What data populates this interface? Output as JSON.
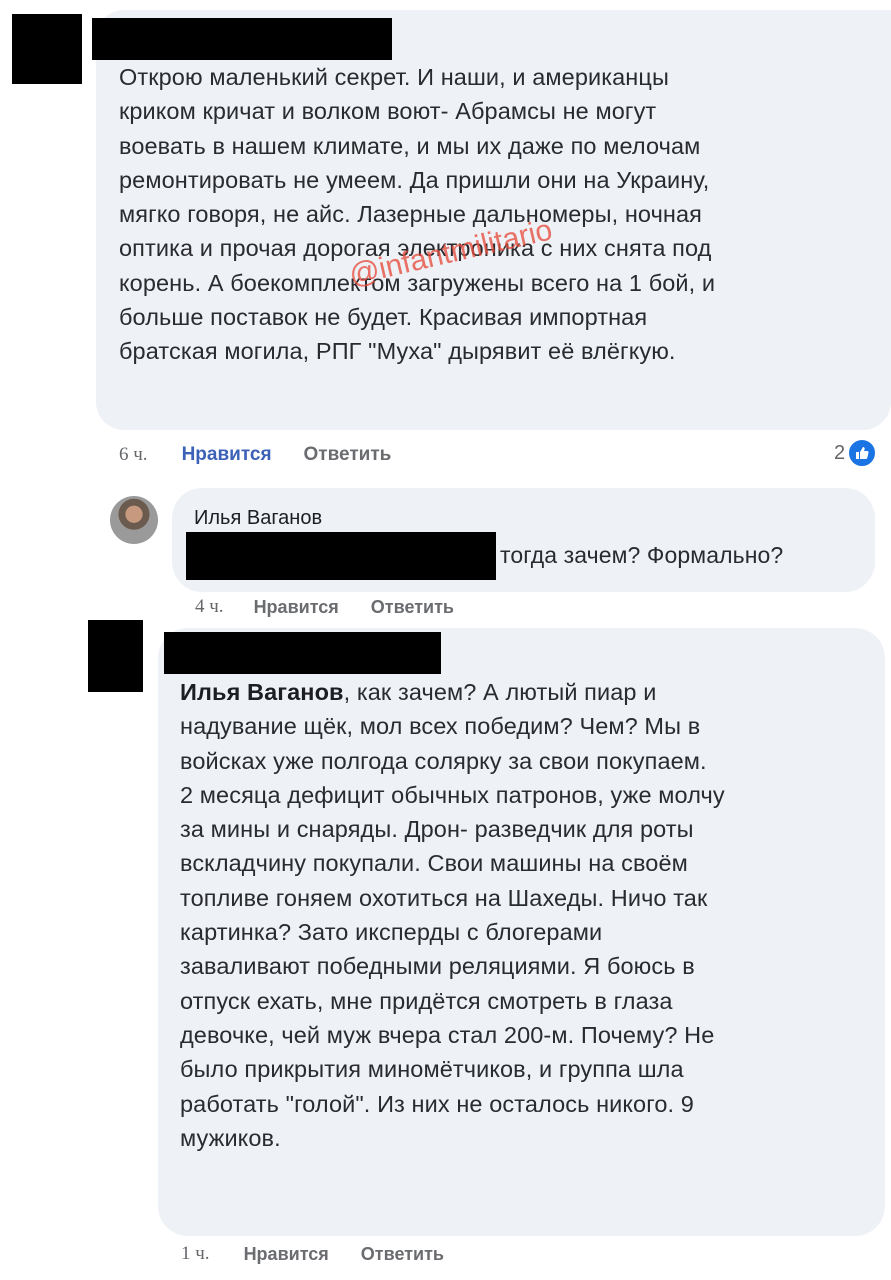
{
  "comments": [
    {
      "id": "c1",
      "text_lines": [
        "Открою маленький секрет. И наши, и американцы",
        "криком кричат и волком воют- Абрамсы не могут",
        "воевать в нашем климате, и мы их даже по мелочам",
        "ремонтировать не умеем. Да пришли они на Украину,",
        "мягко говоря, не айс. Лазерные дальномеры, ночная",
        "оптика и прочая дорогая электроника с них снята под",
        "корень. А боекомплектом загружены всего на 1 бой, и",
        "больше поставок не будет. Красивая импортная",
        "братская могила, РПГ \"Муха\" дырявит её влёгкую."
      ],
      "time": "6 ч.",
      "like_label": "Нравится",
      "reply_label": "Ответить",
      "reaction_count": "2"
    },
    {
      "id": "c2",
      "author": "Илья Ваганов",
      "text": "тогда зачем? Формально?",
      "time": "4 ч.",
      "like_label": "Нравится",
      "reply_label": "Ответить"
    },
    {
      "id": "c3",
      "mention": "Илья Ваганов",
      "first_line_rest": ", как зачем? А лютый пиар и",
      "text_lines": [
        "надувание щёк, мол всех победим? Чем? Мы в",
        "войсках уже полгода солярку за свои покупаем.",
        "2 месяца дефицит обычных патронов, уже молчу",
        "за мины и снаряды. Дрон- разведчик для роты",
        "вскладчину покупали. Свои машины на своём",
        "топливе гоняем охотиться на Шахеды. Ничо так",
        "картинка? Зато иксперды с блогерами",
        "заваливают победными реляциями. Я боюсь в",
        "отпуск ехать, мне придётся смотреть в глаза",
        "девочке, чей муж вчера стал 200-м. Почему? Не",
        "было прикрытия миномётчиков, и группа шла",
        "работать \"голой\". Из них не осталось никого. 9",
        "мужиков."
      ],
      "time": "1 ч.",
      "like_label": "Нравится",
      "reply_label": "Ответить"
    }
  ],
  "watermark": "@infantmilitario",
  "colors": {
    "bubble": "#eef1f5",
    "like_active": "#3b62b6",
    "meta_gray": "#65676b",
    "reaction_blue": "#1b74e4",
    "watermark": "#e74c3c"
  },
  "icons": {
    "reaction": "thumbs-up-icon"
  }
}
